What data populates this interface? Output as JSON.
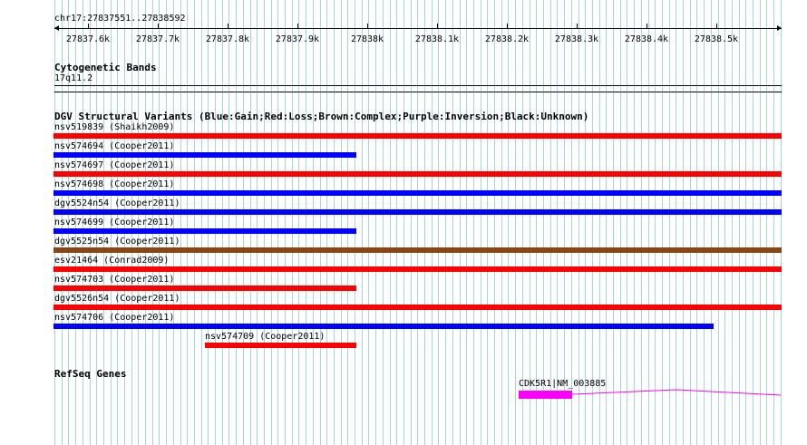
{
  "position": "chr17:27837551..27838592",
  "ruler": {
    "ticks": [
      "27837.6k",
      "27837.7k",
      "27837.8k",
      "27837.9k",
      "27838k",
      "27838.1k",
      "27838.2k",
      "27838.3k",
      "27838.4k",
      "27838.5k"
    ]
  },
  "cytoband": {
    "title": "Cytogenetic Bands",
    "band": "17q11.2"
  },
  "dgv": {
    "title": "DGV Structural Variants (Blue:Gain;Red:Loss;Brown:Complex;Purple:Inversion;Black:Unknown)",
    "colors": {
      "gain": "#0000ff",
      "loss": "#ff0000",
      "complex": "#8b4513",
      "inversion": "#800080",
      "unknown": "#000000"
    },
    "variants": [
      {
        "label": "nsv519839 (Shaikh2009)",
        "type": "loss"
      },
      {
        "label": "nsv574694 (Cooper2011)",
        "type": "gain"
      },
      {
        "label": "nsv574697 (Cooper2011)",
        "type": "loss"
      },
      {
        "label": "nsv574698 (Cooper2011)",
        "type": "gain"
      },
      {
        "label": "dgv5524n54 (Cooper2011)",
        "type": "gain"
      },
      {
        "label": "nsv574699 (Cooper2011)",
        "type": "gain"
      },
      {
        "label": "dgv5525n54 (Cooper2011)",
        "type": "complex"
      },
      {
        "label": "esv21464 (Conrad2009)",
        "type": "loss"
      },
      {
        "label": "nsv574703 (Cooper2011)",
        "type": "loss"
      },
      {
        "label": "dgv5526n54 (Cooper2011)",
        "type": "loss"
      },
      {
        "label": "nsv574706 (Cooper2011)",
        "type": "gain"
      },
      {
        "label": "nsv574709 (Cooper2011)",
        "type": "loss"
      }
    ]
  },
  "refseq": {
    "title": "RefSeq Genes",
    "gene_label": "CDK5R1|NM_003885",
    "gene_color": "#ff00ff"
  }
}
